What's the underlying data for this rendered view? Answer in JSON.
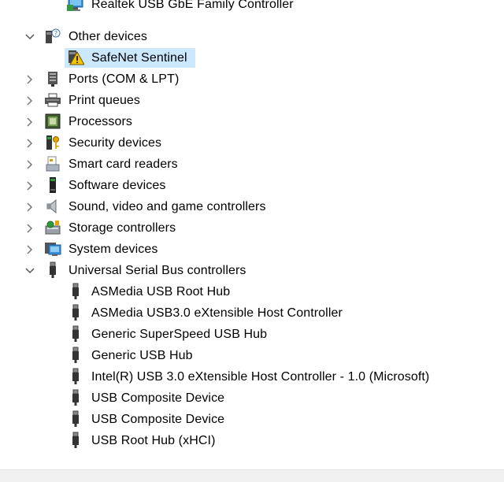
{
  "tree": {
    "partial_top_item": {
      "label": "Realtek USB GbE Family Controller",
      "icon": "network-adapter-icon"
    },
    "categories": [
      {
        "label": "Other devices",
        "icon": "unknown-device-icon",
        "expanded": true
      },
      {
        "label": "Ports (COM & LPT)",
        "icon": "port-icon",
        "expanded": false
      },
      {
        "label": "Print queues",
        "icon": "printer-icon",
        "expanded": false
      },
      {
        "label": "Processors",
        "icon": "processor-icon",
        "expanded": false
      },
      {
        "label": "Security devices",
        "icon": "security-key-icon",
        "expanded": false
      },
      {
        "label": "Smart card readers",
        "icon": "smart-card-reader-icon",
        "expanded": false
      },
      {
        "label": "Software devices",
        "icon": "software-device-icon",
        "expanded": false
      },
      {
        "label": "Sound, video and game controllers",
        "icon": "speaker-icon",
        "expanded": false
      },
      {
        "label": "Storage controllers",
        "icon": "storage-controller-icon",
        "expanded": false
      },
      {
        "label": "System devices",
        "icon": "system-device-icon",
        "expanded": false
      },
      {
        "label": "Universal Serial Bus controllers",
        "icon": "usb-icon",
        "expanded": true
      }
    ],
    "other_devices_children": [
      {
        "label": "SafeNet Sentinel",
        "icon": "warning-device-icon",
        "selected": true
      }
    ],
    "usb_children": [
      {
        "label": "ASMedia USB Root Hub",
        "icon": "usb-icon"
      },
      {
        "label": "ASMedia USB3.0 eXtensible Host Controller",
        "icon": "usb-icon"
      },
      {
        "label": "Generic SuperSpeed USB Hub",
        "icon": "usb-icon"
      },
      {
        "label": "Generic USB Hub",
        "icon": "usb-icon"
      },
      {
        "label": "Intel(R) USB 3.0 eXtensible Host Controller - 1.0 (Microsoft)",
        "icon": "usb-icon"
      },
      {
        "label": "USB Composite Device",
        "icon": "usb-icon"
      },
      {
        "label": "USB Composite Device",
        "icon": "usb-icon"
      },
      {
        "label": "USB Root Hub (xHCI)",
        "icon": "usb-icon"
      }
    ]
  },
  "colors": {
    "selection": "#cce8ff",
    "chevron": "#555555",
    "warning": "#f5c400"
  }
}
